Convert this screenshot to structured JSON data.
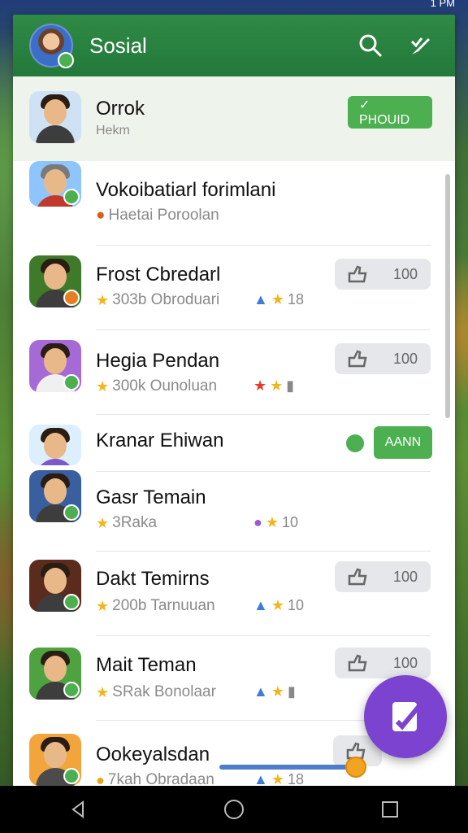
{
  "status_bar": {
    "time": "1 PM"
  },
  "app_bar": {
    "title": "Sosial",
    "search_icon": "search-icon",
    "edit_icon": "edit-check-icon"
  },
  "friends": [
    {
      "name": "Orrok",
      "sub": "Hekm",
      "action": "✓ PHOUID",
      "action_type": "green",
      "avatar_color": "#cfe2f3"
    },
    {
      "name": "Vokoibatiarl forimlani",
      "sub": "Haetai Poroolan",
      "action": "",
      "action_type": "none",
      "avatar_color": "#8ec5ff"
    },
    {
      "name": "Frost Cbredarl",
      "sub": "303b Obroduari",
      "meta": "18",
      "action": "100",
      "action_type": "pill",
      "avatar_color": "#3f7a2a"
    },
    {
      "name": "Hegia Pendan",
      "sub": "300k Ounoluan",
      "meta": "",
      "action": "100",
      "action_type": "pill",
      "avatar_color": "#a56ad6"
    },
    {
      "name": "Kranar Ehiwan",
      "sub": "",
      "action": "AANN",
      "action_type": "green",
      "avatar_color": "#dcefff"
    },
    {
      "name": "Gasr Temain",
      "sub": "3Raka",
      "meta": "10",
      "action": "",
      "action_type": "none",
      "avatar_color": "#3a5f9e"
    },
    {
      "name": "Dakt Temirns",
      "sub": "200b Tarnuuan",
      "meta": "10",
      "action": "100",
      "action_type": "pill",
      "avatar_color": "#5b2b1e"
    },
    {
      "name": "Mait Teman",
      "sub": "SRak Bonolaar",
      "meta": "",
      "action": "100",
      "action_type": "pill",
      "avatar_color": "#4ea340"
    },
    {
      "name": "Ookeyalsdan",
      "sub": "7kah Obradaan",
      "meta": "18",
      "action": "",
      "action_type": "pill-partial",
      "avatar_color": "#f2a53a"
    }
  ],
  "fab": {
    "icon": "compose-icon"
  },
  "nav": {
    "back": "back-icon",
    "home": "home-icon",
    "recents": "recents-icon"
  }
}
